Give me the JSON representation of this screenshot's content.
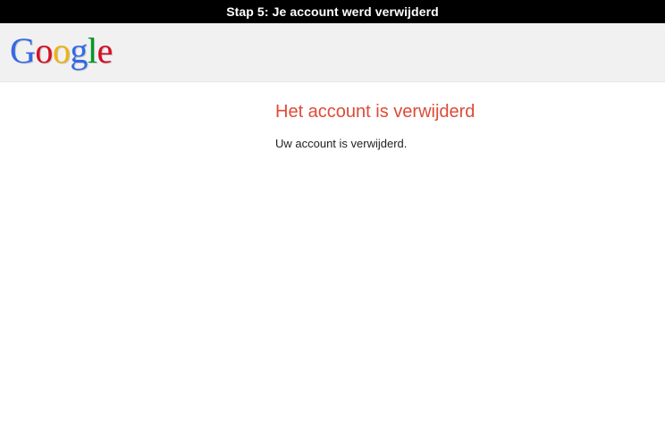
{
  "caption": {
    "text": "Stap 5: Je account werd verwijderd"
  },
  "header": {
    "logo": {
      "icon": "google-logo",
      "letters": [
        "G",
        "o",
        "o",
        "g",
        "l",
        "e"
      ],
      "colors": [
        "#3369e8",
        "#d50f25",
        "#eeb211",
        "#3369e8",
        "#009925",
        "#d50f25"
      ]
    }
  },
  "main": {
    "title": "Het account is verwijderd",
    "title_color": "#dd4b39",
    "message": "Uw account is verwijderd."
  }
}
